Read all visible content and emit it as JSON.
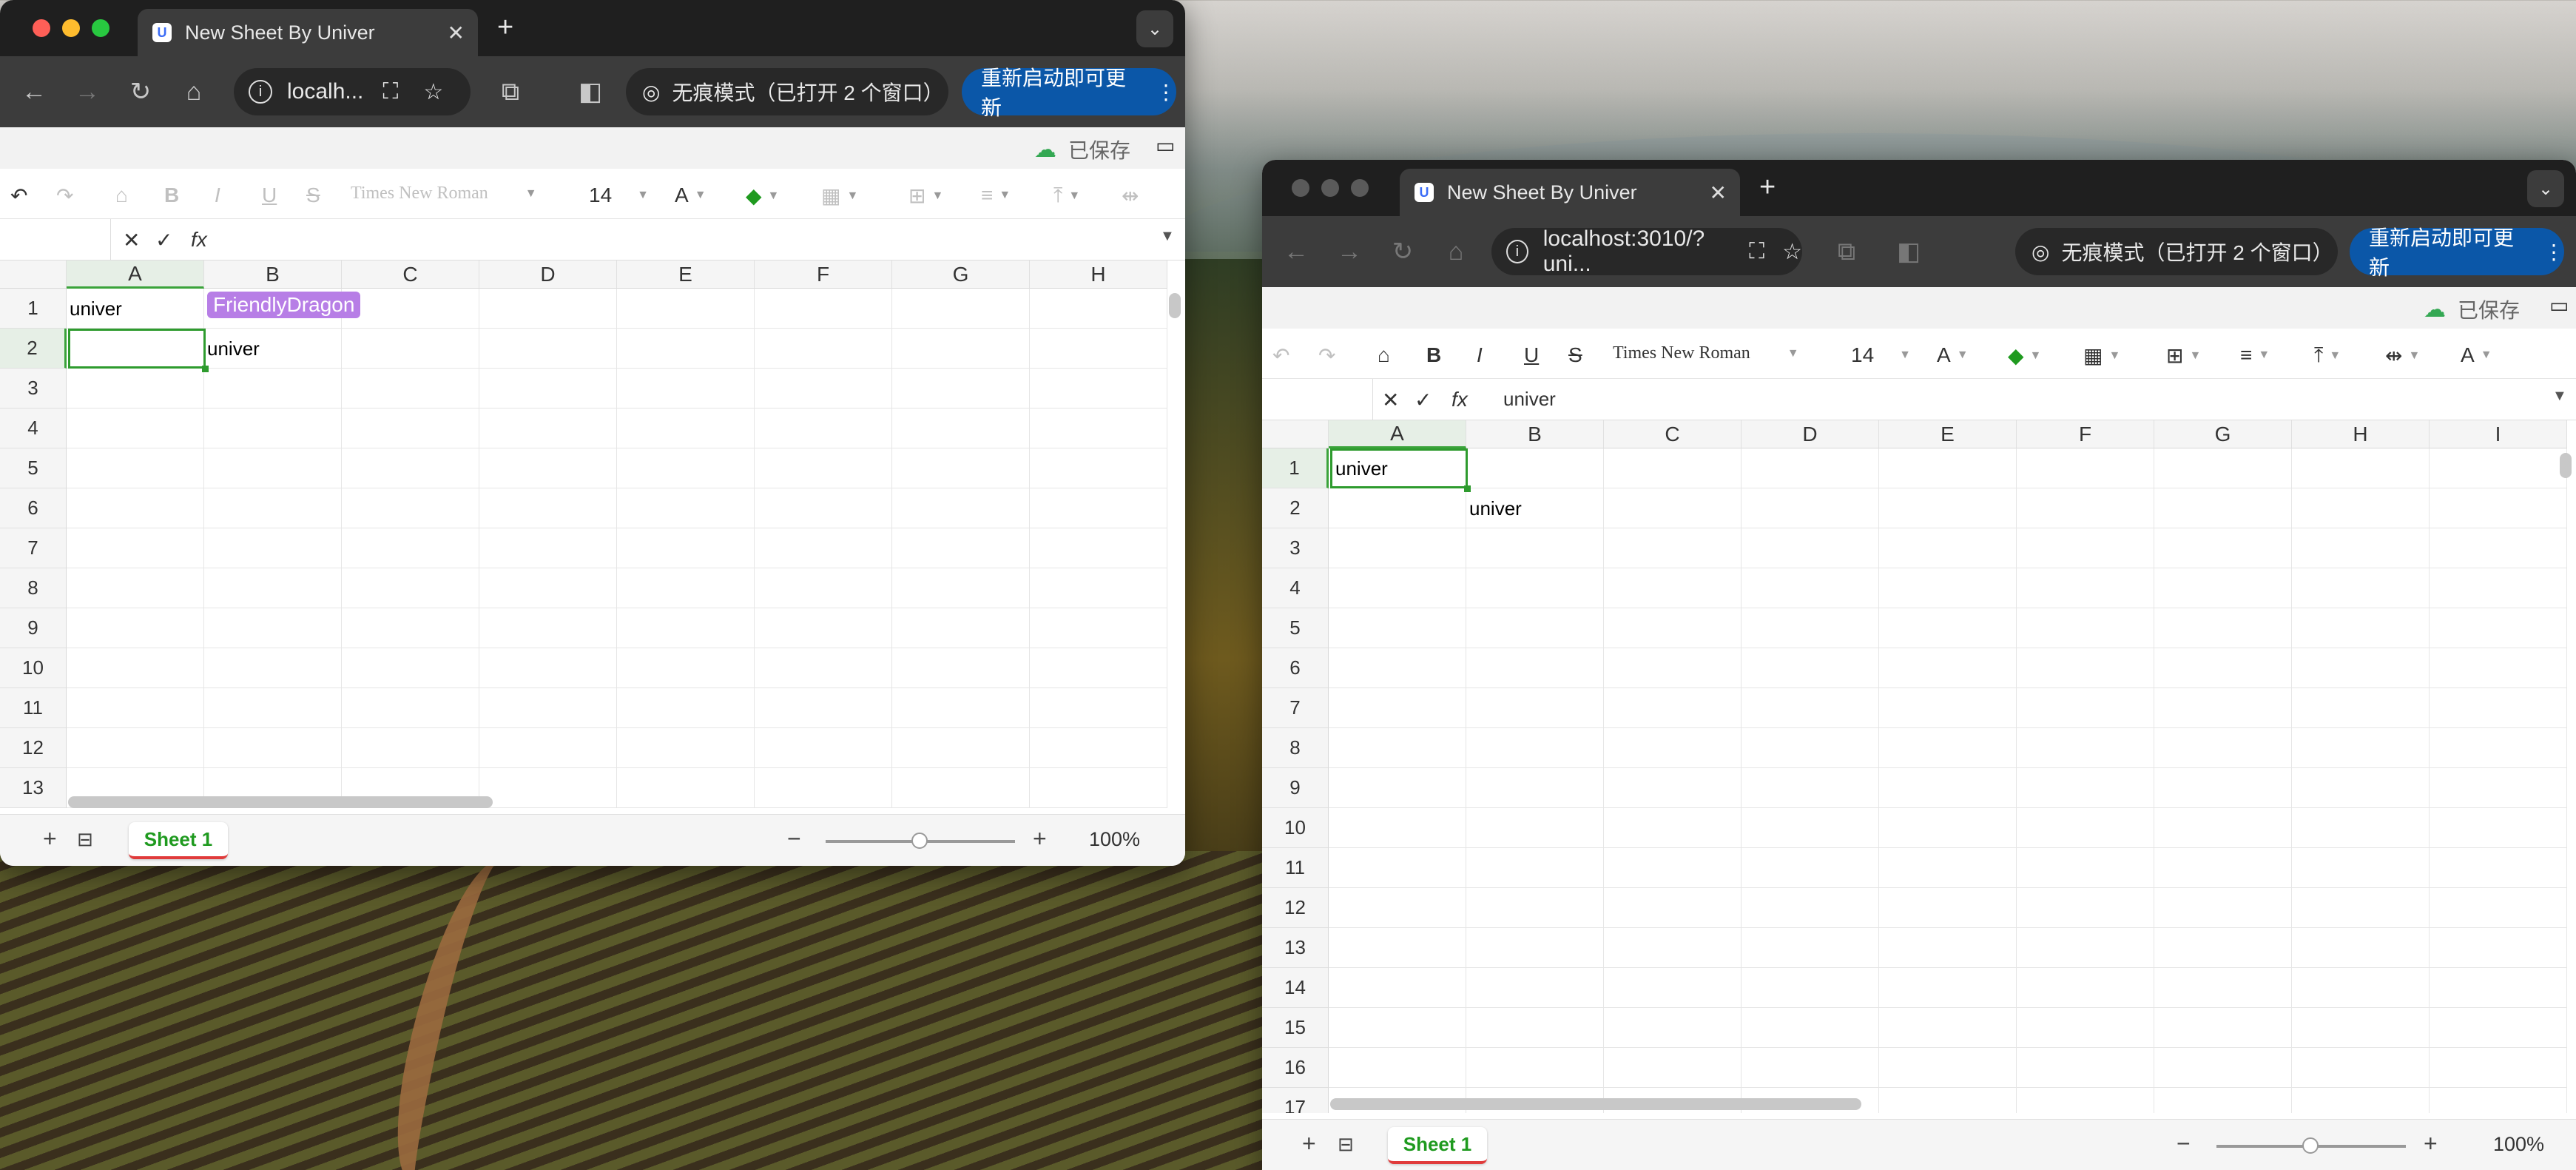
{
  "colors": {
    "accent": "#2e9b2e",
    "collab": "#b77ee6",
    "update": "#0b57a8",
    "sheettab": "#1f9a1f"
  },
  "left": {
    "tab_title": "New Sheet By Univer",
    "address": "localh...",
    "incognito": "无痕模式（已打开 2 个窗口）",
    "update": "重新启动即可更新",
    "saved": "已保存",
    "font": "Times New Roman",
    "font_size": "14",
    "cols": [
      "A",
      "B",
      "C",
      "D",
      "E",
      "F",
      "G",
      "H"
    ],
    "rows": [
      "1",
      "2",
      "3",
      "4",
      "5",
      "6",
      "7",
      "8",
      "9",
      "10",
      "11",
      "12",
      "13"
    ],
    "a1": "univer",
    "b2": "univer",
    "collaborator": "FriendlyDragon",
    "sheet": "Sheet 1",
    "zoom": "100%",
    "zoom_value": 0.5
  },
  "right": {
    "tab_title": "New Sheet By Univer",
    "address": "localhost:3010/?uni...",
    "incognito": "无痕模式（已打开 2 个窗口）",
    "update": "重新启动即可更新",
    "saved": "已保存",
    "font": "Times New Roman",
    "font_size": "14",
    "formula_value": "univer",
    "cols": [
      "A",
      "B",
      "C",
      "D",
      "E",
      "F",
      "G",
      "H",
      "I"
    ],
    "rows": [
      "1",
      "2",
      "3",
      "4",
      "5",
      "6",
      "7",
      "8",
      "9",
      "10",
      "11",
      "12",
      "13",
      "14",
      "15",
      "16",
      "17"
    ],
    "a1": "univer",
    "b2": "univer",
    "sheet": "Sheet 1",
    "zoom": "100%",
    "zoom_value": 0.5
  }
}
